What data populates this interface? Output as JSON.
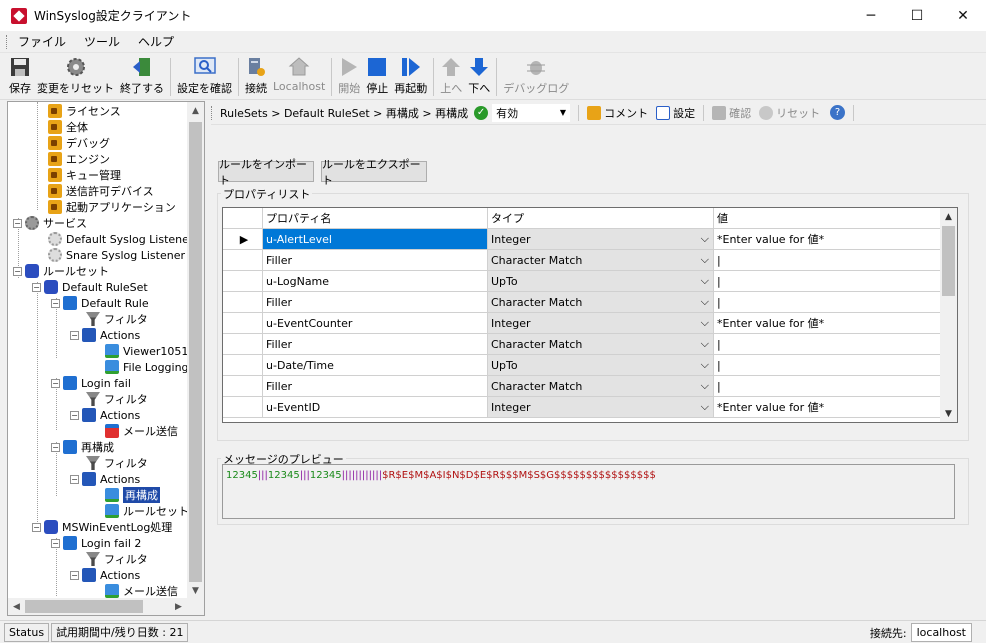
{
  "window": {
    "title": "WinSyslog設定クライアント",
    "minimize": "─",
    "maximize": "☐",
    "close": "✕"
  },
  "menu": [
    "ファイル",
    "ツール",
    "ヘルプ"
  ],
  "toolbar": {
    "save": "保存",
    "reset_changes": "変更をリセット",
    "exit": "終了する",
    "verify_config": "設定を確認",
    "connect": "接続",
    "localhost": "Localhost",
    "start": "開始",
    "stop": "停止",
    "restart": "再起動",
    "up": "上へ",
    "down": "下へ",
    "debug_log": "デバッグログ"
  },
  "tree": [
    {
      "label": "ライセンス",
      "icon": "lock-icon"
    },
    {
      "label": "全体",
      "icon": "lock-icon"
    },
    {
      "label": "デバッグ",
      "icon": "lock-icon"
    },
    {
      "label": "エンジン",
      "icon": "lock-icon"
    },
    {
      "label": "キュー管理",
      "icon": "lock-icon"
    },
    {
      "label": "送信許可デバイス",
      "icon": "lock-icon"
    },
    {
      "label": "起動アプリケーション",
      "icon": "lock-icon"
    },
    {
      "label": "サービス",
      "icon": "gear-icon"
    },
    {
      "label": "Default Syslog Listener",
      "icon": "gear-icon"
    },
    {
      "label": "Snare Syslog Listener",
      "icon": "gear-icon"
    },
    {
      "label": "ルールセット",
      "icon": "ruleset-icon"
    },
    {
      "label": "Default RuleSet",
      "icon": "ruleset-icon"
    },
    {
      "label": "Default Rule",
      "icon": "rule-icon"
    },
    {
      "label": "フィルタ",
      "icon": "filter-icon"
    },
    {
      "label": "Actions",
      "icon": "actions-icon"
    },
    {
      "label": "Viewer1051",
      "icon": "action-icon"
    },
    {
      "label": "File Logging",
      "icon": "action-icon"
    },
    {
      "label": "Login fail",
      "icon": "rule-icon"
    },
    {
      "label": "フィルタ",
      "icon": "filter-icon"
    },
    {
      "label": "Actions",
      "icon": "actions-icon"
    },
    {
      "label": "メール送信",
      "icon": "mail-icon"
    },
    {
      "label": "再構成",
      "icon": "rule-icon"
    },
    {
      "label": "フィルタ",
      "icon": "filter-icon"
    },
    {
      "label": "Actions",
      "icon": "actions-icon"
    },
    {
      "label": "再構成",
      "icon": "action-icon"
    },
    {
      "label": "ルールセット(",
      "icon": "action-icon"
    },
    {
      "label": "MSWinEventLog処理",
      "icon": "ruleset-icon"
    },
    {
      "label": "Login fail 2",
      "icon": "rule-icon"
    },
    {
      "label": "フィルタ",
      "icon": "filter-icon"
    },
    {
      "label": "Actions",
      "icon": "actions-icon"
    },
    {
      "label": "メール送信",
      "icon": "action-icon"
    }
  ],
  "breadcrumb": "RuleSets > Default RuleSet > 再構成 > 再構成",
  "enabled_select": "有効",
  "bar_buttons": {
    "comment": "コメント",
    "settings": "設定",
    "confirm": "確認",
    "reset": "リセット"
  },
  "import_button": "ルールをインポート",
  "export_button": "ルールをエクスポート",
  "property_list_title": "プロパティリスト",
  "grid": {
    "headers": {
      "name": "プロパティ名",
      "type": "タイプ",
      "value": "値"
    },
    "rows": [
      {
        "name": "u-AlertLevel",
        "type": "Integer",
        "value": "*Enter value for 値*"
      },
      {
        "name": "Filler",
        "type": "Character Match",
        "value": "|"
      },
      {
        "name": "u-LogName",
        "type": "UpTo",
        "value": "|"
      },
      {
        "name": "Filler",
        "type": "Character Match",
        "value": "|"
      },
      {
        "name": "u-EventCounter",
        "type": "Integer",
        "value": "*Enter value for 値*"
      },
      {
        "name": "Filler",
        "type": "Character Match",
        "value": "|"
      },
      {
        "name": "u-Date/Time",
        "type": "UpTo",
        "value": "|"
      },
      {
        "name": "Filler",
        "type": "Character Match",
        "value": "|"
      },
      {
        "name": "u-EventID",
        "type": "Integer",
        "value": "*Enter value for 値*"
      }
    ]
  },
  "preview_title": "メッセージのプレビュー",
  "preview": {
    "part1": "12345",
    "part2": "|||",
    "part3": "12345",
    "part4": "|||",
    "part5": "12345",
    "part6": "||||||||||||",
    "part7": "$R$E$M$A$I$N$D$E$R$$$M$S$G$$$$$$$$$$$$$$$$"
  },
  "status": {
    "status_label": "Status",
    "trial": "試用期間中/残り日数 : 21",
    "connected_label": "接続先:",
    "server": "localhost"
  },
  "colors": {
    "selection": "#0078d7",
    "tree_selection": "#1f4aa8",
    "preview_green": "#1a8a1a",
    "preview_purple": "#8a1aa0",
    "preview_red": "#b01010"
  }
}
